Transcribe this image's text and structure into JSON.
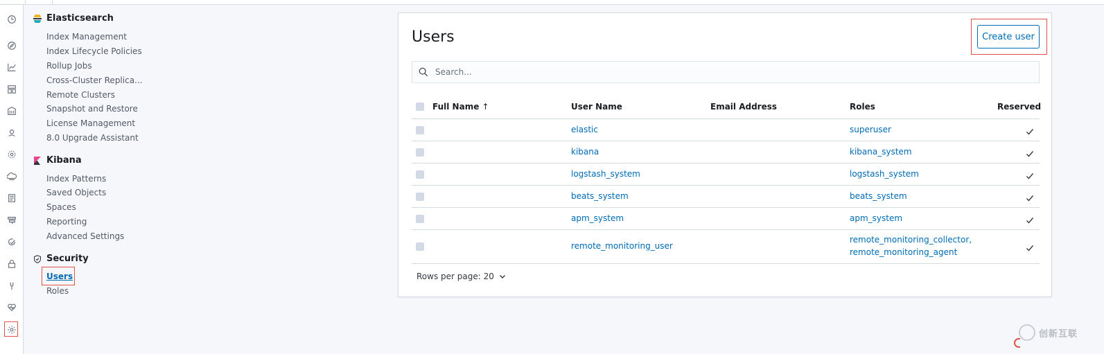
{
  "sidenav": {
    "sections": [
      {
        "title": "Elasticsearch",
        "items": [
          "Index Management",
          "Index Lifecycle Policies",
          "Rollup Jobs",
          "Cross-Cluster Replica...",
          "Remote Clusters",
          "Snapshot and Restore",
          "License Management",
          "8.0 Upgrade Assistant"
        ]
      },
      {
        "title": "Kibana",
        "items": [
          "Index Patterns",
          "Saved Objects",
          "Spaces",
          "Reporting",
          "Advanced Settings"
        ]
      },
      {
        "title": "Security",
        "items": [
          "Users",
          "Roles"
        ]
      }
    ]
  },
  "rail_icons": [
    "clock-icon",
    "compass-icon",
    "visualize-icon",
    "dashboard-icon",
    "canvas-icon",
    "maps-icon",
    "ml-icon",
    "infrastructure-icon",
    "logs-icon",
    "apm-icon",
    "uptime-icon",
    "siem-icon",
    "dev-tools-icon",
    "monitoring-icon",
    "management-icon"
  ],
  "main": {
    "title": "Users",
    "create_label": "Create user",
    "search_placeholder": "Search...",
    "columns": [
      "Full Name",
      "User Name",
      "Email Address",
      "Roles",
      "Reserved"
    ],
    "sort_indicator": "↑",
    "rows": [
      {
        "full_name": "",
        "username": "elastic",
        "email": "",
        "roles": [
          "superuser"
        ],
        "reserved": true
      },
      {
        "full_name": "",
        "username": "kibana",
        "email": "",
        "roles": [
          "kibana_system"
        ],
        "reserved": true
      },
      {
        "full_name": "",
        "username": "logstash_system",
        "email": "",
        "roles": [
          "logstash_system"
        ],
        "reserved": true
      },
      {
        "full_name": "",
        "username": "beats_system",
        "email": "",
        "roles": [
          "beats_system"
        ],
        "reserved": true
      },
      {
        "full_name": "",
        "username": "apm_system",
        "email": "",
        "roles": [
          "apm_system"
        ],
        "reserved": true
      },
      {
        "full_name": "",
        "username": "remote_monitoring_user",
        "email": "",
        "roles": [
          "remote_monitoring_collector,",
          "remote_monitoring_agent"
        ],
        "reserved": true
      }
    ],
    "rows_per_page": "Rows per page: 20"
  },
  "watermark": {
    "text": "创新互联"
  },
  "colors": {
    "accent": "#006bb4",
    "highlight": "#e0534d"
  }
}
